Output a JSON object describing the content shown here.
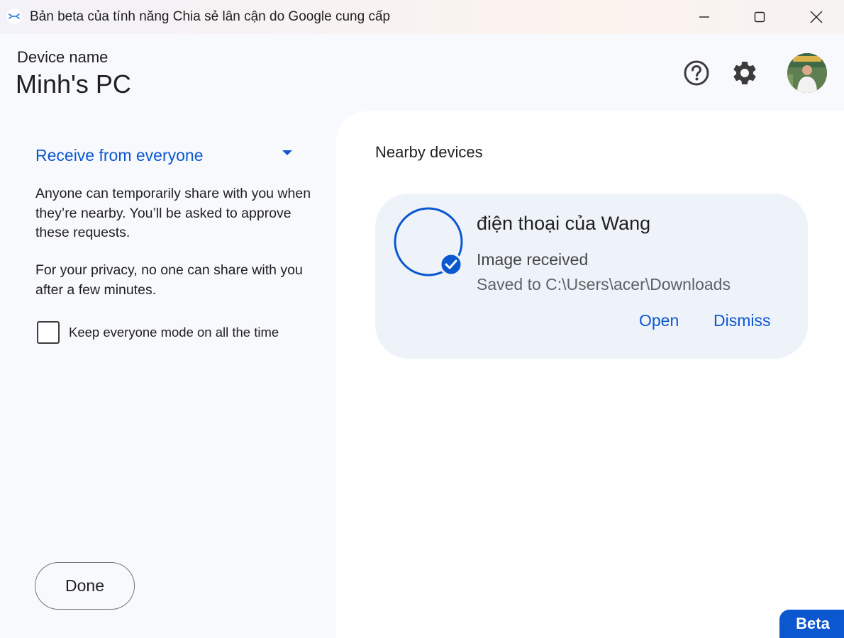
{
  "window": {
    "title": "Bản beta của tính năng Chia sẻ lân cận do Google cung cấp",
    "app_icon": "nearby-share-icon",
    "controls": [
      "minimize-icon",
      "maximize-icon",
      "close-icon"
    ]
  },
  "header": {
    "device_label": "Device name",
    "device_name": "Minh's PC",
    "icons": [
      "help-icon",
      "settings-icon",
      "avatar"
    ]
  },
  "left_panel": {
    "visibility_select": "Receive from everyone",
    "description_1": "Anyone can temporarily share with you when they’re nearby. You’ll be asked to approve these requests.",
    "description_2": "For your privacy, no one can share with you after a few minutes.",
    "checkbox_label": "Keep everyone mode on all the time",
    "checkbox_checked": false,
    "done_label": "Done"
  },
  "right_panel": {
    "title": "Nearby devices",
    "device_card": {
      "device_name": "điện thoại của Wang",
      "status": "Image received",
      "saved_path": "Saved to C:\\Users\\acer\\Downloads",
      "open_label": "Open",
      "dismiss_label": "Dismiss"
    }
  },
  "badge": {
    "label": "Beta"
  },
  "colors": {
    "accent": "#0b57d0",
    "card_background": "#eef2f9",
    "panel_background": "#f8f9fc"
  }
}
